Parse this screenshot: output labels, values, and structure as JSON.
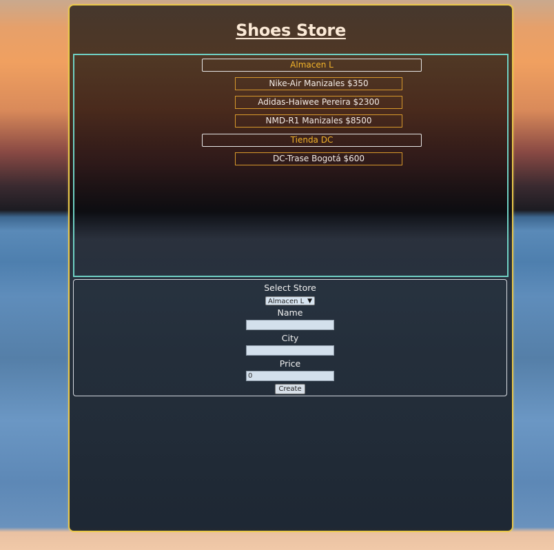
{
  "header": {
    "title": "Shoes Store"
  },
  "stores": [
    {
      "name": "Almacen L",
      "shoes": [
        "Nike-Air Manizales $350",
        "Adidas-Haiwee Pereira $2300",
        "NMD-R1 Manizales $8500"
      ]
    },
    {
      "name": "Tienda DC",
      "shoes": [
        "DC-Trase Bogotá $600"
      ]
    }
  ],
  "form": {
    "select_store_label": "Select Store",
    "selected_store": "Almacen L",
    "name_label": "Name",
    "name_value": "",
    "city_label": "City",
    "city_value": "",
    "price_label": "Price",
    "price_value": "0",
    "create_label": "Create"
  },
  "colors": {
    "container_border": "#e9c84a",
    "list_border": "#6fd1c4",
    "store_name": "#f2b32a",
    "item_border": "#d99a2c"
  }
}
